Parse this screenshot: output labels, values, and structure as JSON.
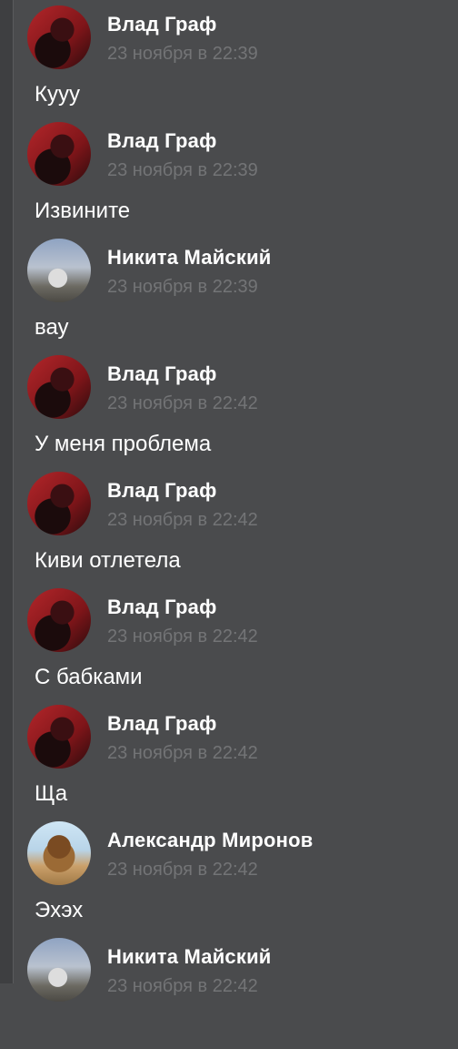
{
  "messages": [
    {
      "author": "Влад Граф",
      "time": "23 ноября в 22:39",
      "text": "Кууу",
      "avatar": "red-portrait-avatar"
    },
    {
      "author": "Влад Граф",
      "time": "23 ноября в 22:39",
      "text": "Извините",
      "avatar": "red-portrait-avatar"
    },
    {
      "author": "Никита Майский",
      "time": "23 ноября в 22:39",
      "text": "вау",
      "avatar": "wolf-photo-avatar"
    },
    {
      "author": "Влад Граф",
      "time": "23 ноября в 22:42",
      "text": "У меня проблема",
      "avatar": "red-portrait-avatar"
    },
    {
      "author": "Влад Граф",
      "time": "23 ноября в 22:42",
      "text": "Киви отлетела",
      "avatar": "red-portrait-avatar"
    },
    {
      "author": "Влад Граф",
      "time": "23 ноября в 22:42",
      "text": "С бабками",
      "avatar": "red-portrait-avatar"
    },
    {
      "author": "Влад Граф",
      "time": "23 ноября в 22:42",
      "text": "Ща",
      "avatar": "red-portrait-avatar"
    },
    {
      "author": "Александр Миронов",
      "time": "23 ноября в 22:42",
      "text": "Эхэх",
      "avatar": "lion-photo-avatar"
    },
    {
      "author": "Никита Майский",
      "time": "23 ноября в 22:42",
      "text": "",
      "avatar": "wolf-photo-avatar"
    }
  ]
}
